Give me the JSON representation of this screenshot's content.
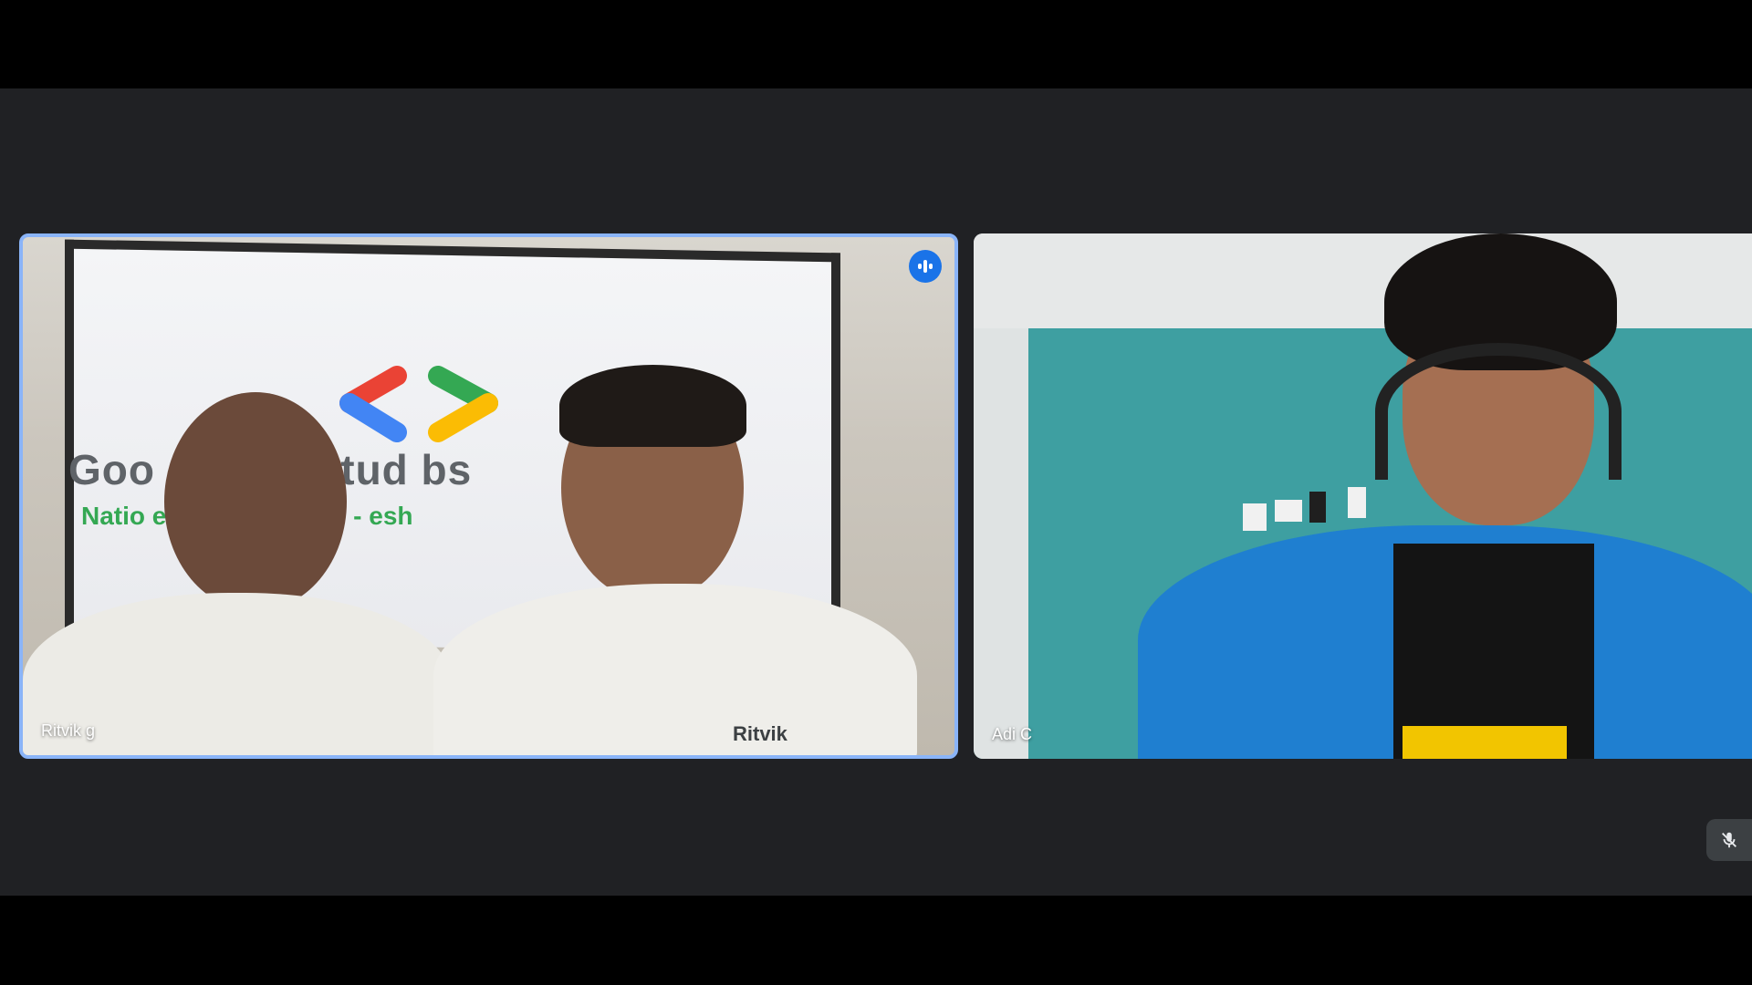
{
  "meeting": {
    "participants": [
      {
        "name": "Ritvik g",
        "is_speaking": true,
        "screen_heading": "Goo        eloper Stud       bs",
        "screen_subheading": "Natio        e of Technology -         esh",
        "shirt_text": "Ritvik"
      },
      {
        "name": "Adi C",
        "is_speaking": false
      }
    ],
    "controls": {
      "mic_state": "muted"
    }
  },
  "colors": {
    "stage_background": "#202124",
    "active_speaker_border": "#8ab4f8",
    "speaking_badge": "#1a73e8",
    "control_button": "#3c4043"
  },
  "icons": {
    "speaking_indicator": "audio-level-icon",
    "mic_muted": "mic-off-icon"
  }
}
